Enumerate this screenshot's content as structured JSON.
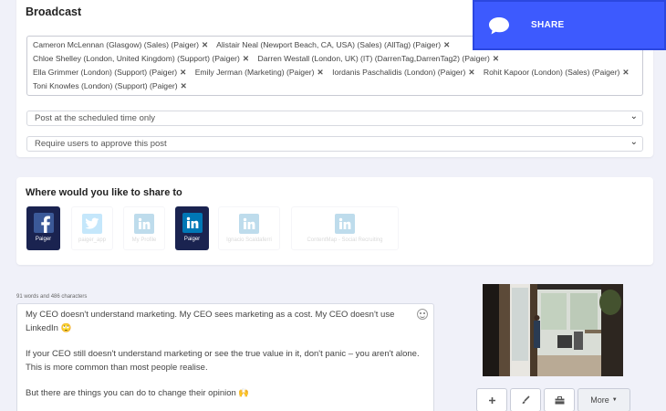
{
  "broadcast": {
    "title": "Broadcast",
    "recipients": [
      "Cameron McLennan (Glasgow) (Sales) (Paiger)",
      "Alistair Neal (Newport Beach, CA, USA) (Sales) (AllTag) (Paiger)",
      "Chloe Shelley (London, United Kingdom) (Support) (Paiger)",
      "Darren Westall (London, UK) (IT) (DarrenTag,DarrenTag2) (Paiger)",
      "Ella Grimmer (London) (Support) (Paiger)",
      "Emily Jerman (Marketing) (Paiger)",
      "Iordanis Paschalidis (London) (Paiger)",
      "Rohit Kapoor (London) (Sales) (Paiger)",
      "Toni Knowles (London) (Support) (Paiger)"
    ],
    "remove_symbol": "✕",
    "schedule_select": "Post at the scheduled time only",
    "approval_select": "Require users to approve this post"
  },
  "share_button": {
    "label": "SHARE",
    "icon": "chat-bubble-icon"
  },
  "destinations": {
    "title": "Where would you like to share to",
    "items": [
      {
        "label": "Paiger",
        "network": "facebook",
        "selected": true
      },
      {
        "label": "paiger_app",
        "network": "twitter",
        "selected": false
      },
      {
        "label": "My Profile",
        "network": "linkedin",
        "selected": false
      },
      {
        "label": "Paiger",
        "network": "linkedin",
        "selected": true
      },
      {
        "label": "Ignacio Scaldaferri",
        "network": "linkedin",
        "selected": false
      },
      {
        "label": "ContentMap - Social Recruiting",
        "network": "linkedin",
        "selected": false
      }
    ]
  },
  "editor": {
    "word_count": "91 words and 486 characters",
    "paragraphs": [
      "My CEO doesn't understand marketing. My CEO sees marketing as a cost. My CEO doesn't use LinkedIn 🙄",
      "If your CEO still doesn't understand marketing or see the true value in it, don't panic – you aren't alone. This is more common than most people realise.",
      "But there are things you can do to change their opinion 🙌"
    ]
  },
  "tools": {
    "more_label": "More"
  },
  "colors": {
    "share_bg": "#3d5afe",
    "selected_dest_bg": "#1a2350",
    "facebook": "#3b5998",
    "twitter": "#1da1f2",
    "linkedin": "#0077b5",
    "accent": "#29c5d6"
  }
}
